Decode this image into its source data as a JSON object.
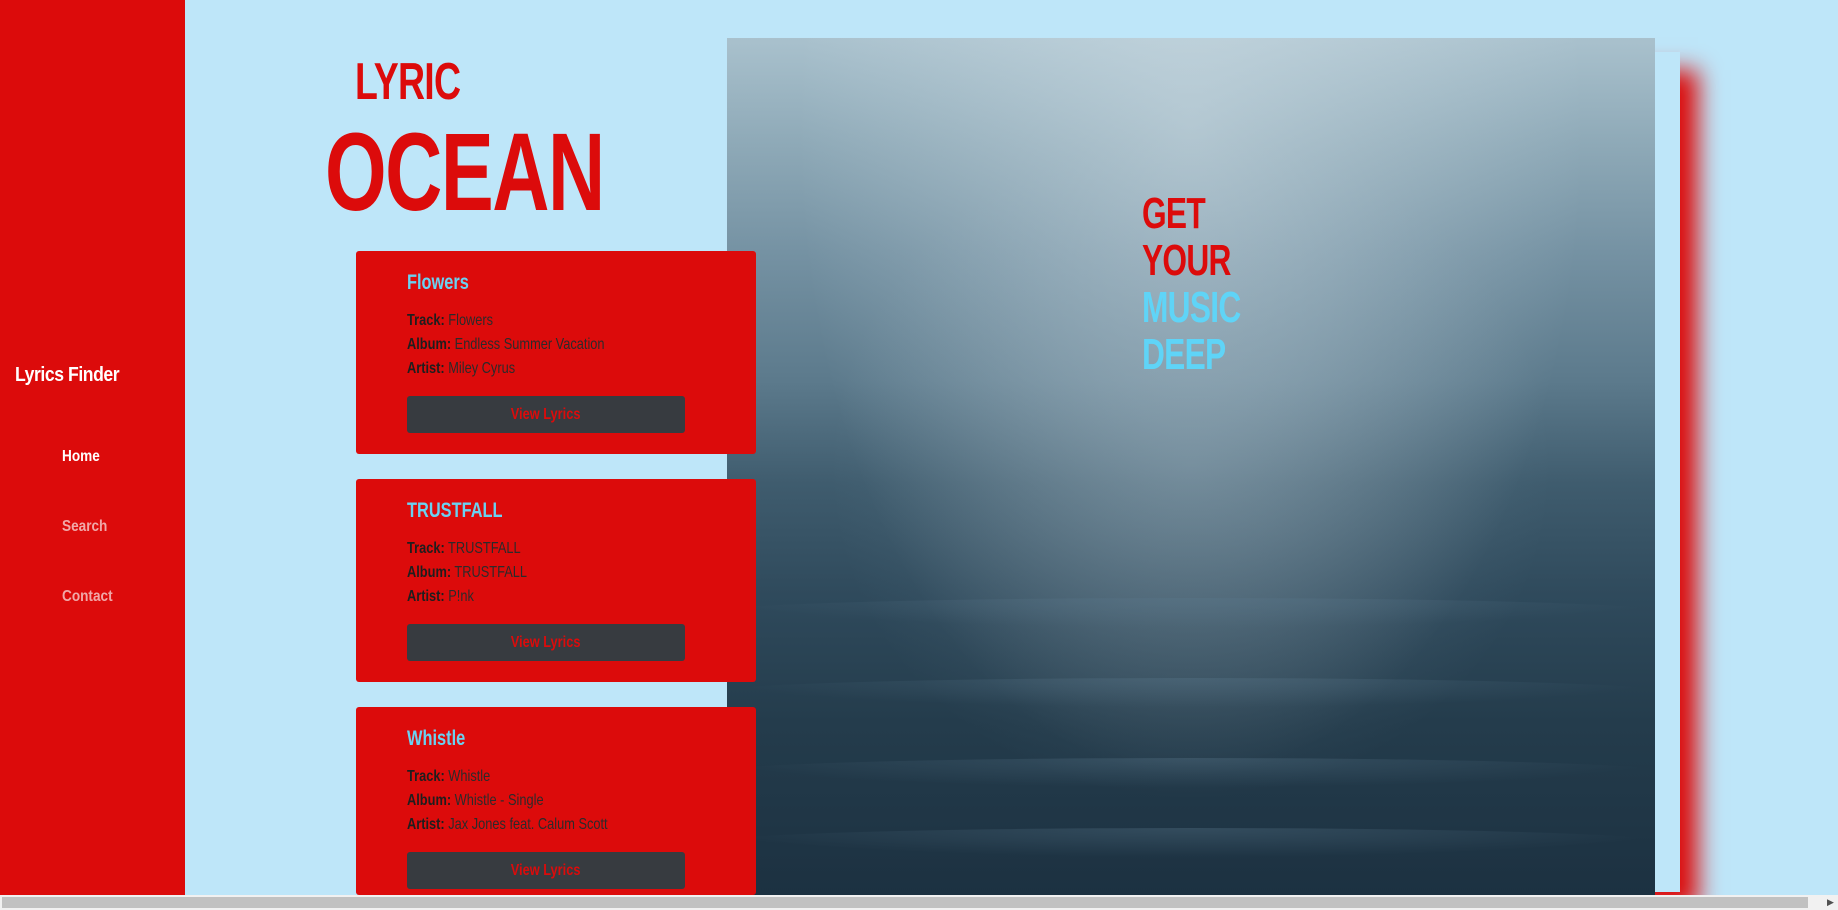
{
  "sidebar": {
    "brand": "Lyrics Finder",
    "nav": [
      "Home",
      "Search",
      "Contact"
    ]
  },
  "title": {
    "line1": "LYRIC",
    "line2": "OCEAN"
  },
  "hero": {
    "tagline": [
      "GET",
      "YOUR",
      "MUSIC",
      "DEEP"
    ]
  },
  "labels": {
    "track": "Track:",
    "album": "Album:",
    "artist": "Artist:",
    "button": "View Lyrics"
  },
  "cards": [
    {
      "title": "Flowers",
      "track": "Flowers",
      "album": "Endless Summer Vacation",
      "artist": "Miley Cyrus"
    },
    {
      "title": "TRUSTFALL",
      "track": "TRUSTFALL",
      "album": "TRUSTFALL",
      "artist": "P!nk"
    },
    {
      "title": "Whistle",
      "track": "Whistle",
      "album": "Whistle - Single",
      "artist": "Jax Jones feat. Calum Scott"
    }
  ],
  "colors": {
    "accent": "#dc0b0b",
    "background": "#bee6f9",
    "highlight": "#5fd4f7",
    "button": "#373b40"
  },
  "icons": {
    "scroll_right": "arrow-right-icon"
  }
}
